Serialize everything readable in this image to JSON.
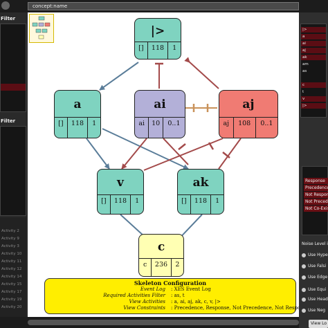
{
  "search": {
    "value": "concept:name"
  },
  "left_panel": {
    "filter_title_1": "Filter",
    "filter_title_2": "Filter",
    "activity_items": [
      "Activity 2",
      "Activity 9",
      "Activity 3",
      "Activity 10",
      "Activity 11",
      "Activity 12",
      "Activity 14",
      "Activity 15",
      "Activity 17",
      "Activity 19",
      "Activity 20"
    ]
  },
  "graph": {
    "nodes": [
      {
        "id": "start",
        "label": "|>",
        "cells": [
          "[]",
          "118",
          "1"
        ],
        "color": "#7fd3c0"
      },
      {
        "id": "a",
        "label": "a",
        "cells": [
          "[]",
          "118",
          "1"
        ],
        "color": "#7fd3c0"
      },
      {
        "id": "ai",
        "label": "ai",
        "cells": [
          "ai",
          "10",
          "0..1"
        ],
        "color": "#b3b0d8"
      },
      {
        "id": "aj",
        "label": "aj",
        "cells": [
          "aj",
          "108",
          "0..1"
        ],
        "color": "#f07b73"
      },
      {
        "id": "v",
        "label": "v",
        "cells": [
          "[]",
          "118",
          "1"
        ],
        "color": "#7fd3c0"
      },
      {
        "id": "ak",
        "label": "ak",
        "cells": [
          "[]",
          "118",
          "1"
        ],
        "color": "#7fd3c0"
      },
      {
        "id": "c",
        "label": "c",
        "cells": [
          "c",
          "236",
          "2"
        ],
        "color": "#ffffb3"
      }
    ]
  },
  "skeleton": {
    "title": "Skeleton Configuration",
    "rows": [
      {
        "key": "Event Log",
        "value": ": XES Event Log"
      },
      {
        "key": "Required Activities Filter",
        "value": ": as, t"
      },
      {
        "key": "View Activities",
        "value": ": a, ai, aj, ak, c, v, |>"
      },
      {
        "key": "View Constraints",
        "value": ": Precedence, Response, Not Precedence, Not Response, Not Co-Existence"
      }
    ]
  },
  "right_panel": {
    "activities": [
      "|>",
      "a",
      "ai",
      "aj",
      "ak",
      "am",
      "as",
      "c",
      "t",
      "v",
      "|>"
    ],
    "constraints": [
      "Response",
      "Precedence",
      "Not Response",
      "Not Precedence",
      "Not Co-Existence"
    ],
    "noise_label": "Noise Level in",
    "options": [
      "Use Hype",
      "Use Falsi",
      "Use Edge",
      "Use Equi",
      "Use Head",
      "Use Neg"
    ],
    "view_button": "View Lo"
  },
  "colors": {
    "node_teal": "#7fd3c0",
    "node_purple": "#b3b0d8",
    "node_red": "#f07b73",
    "node_yellow": "#ffffb3",
    "response_arrow": "#5a7d99",
    "not_arrow": "#a34a4a",
    "coexist_bar": "#c9925a",
    "skeleton_bg": "#ffee00"
  }
}
